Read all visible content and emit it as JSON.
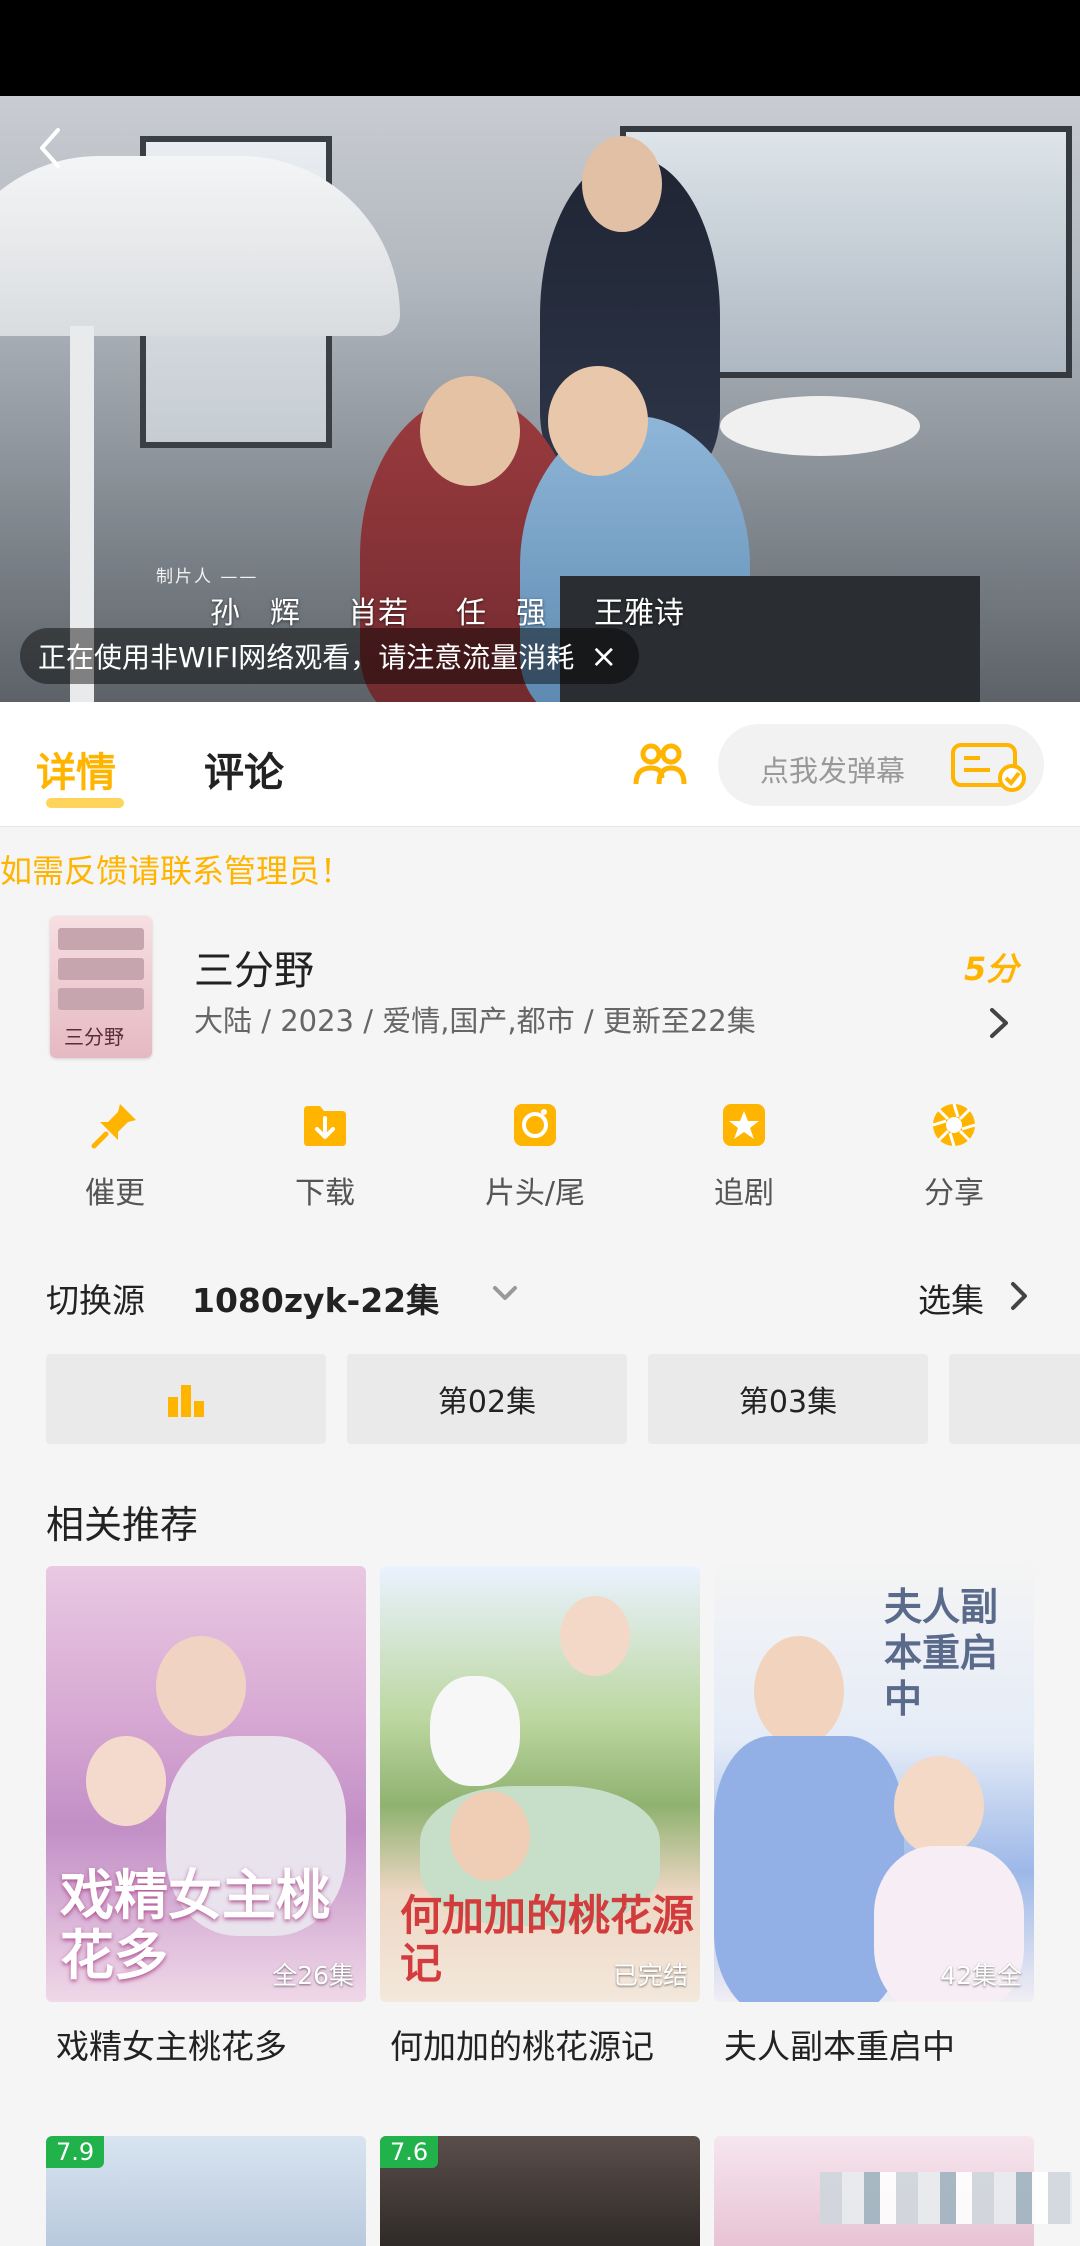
{
  "player": {
    "credit_label": "制片人 ——",
    "credit_names": [
      "孙　辉",
      "肖若",
      "任　强",
      "王雅诗"
    ],
    "wifi_notice": "正在使用非WIFI网络观看，请注意流量消耗",
    "close_glyph": "×"
  },
  "tabs": {
    "detail": "详情",
    "comment": "评论",
    "danmu_placeholder": "点我发弹幕"
  },
  "notice": "如需反馈请联系管理员！",
  "show": {
    "title": "三分野",
    "meta": "大陆 / 2023 / 爱情,国产,都市 / 更新至22集",
    "score": "5分",
    "poster_text": "三分野"
  },
  "actions": [
    {
      "label": "催更",
      "icon": "pin-icon"
    },
    {
      "label": "下载",
      "icon": "download-folder-icon"
    },
    {
      "label": "片头/尾",
      "icon": "skip-intro-icon"
    },
    {
      "label": "追剧",
      "icon": "star-icon"
    },
    {
      "label": "分享",
      "icon": "share-aperture-icon"
    }
  ],
  "source": {
    "label": "切换源",
    "value": "1080zyk-22集",
    "select_episode": "选集"
  },
  "episodes": [
    "第02集",
    "第03集"
  ],
  "recommend": {
    "title": "相关推荐",
    "items": [
      {
        "name": "戏精女主桃花多",
        "badge": "全26集",
        "art_text": "戏精女主桃花多"
      },
      {
        "name": "何加加的桃花源记",
        "badge": "已完结",
        "art_text": "何加加的桃花源记"
      },
      {
        "name": "夫人副本重启中",
        "badge": "42集全",
        "art_text": "夫人副本重启中"
      }
    ],
    "next_row_ratings": [
      "7.9",
      "7.6"
    ]
  },
  "colors": {
    "accent": "#ffb400",
    "rating_green": "#22b24c"
  }
}
